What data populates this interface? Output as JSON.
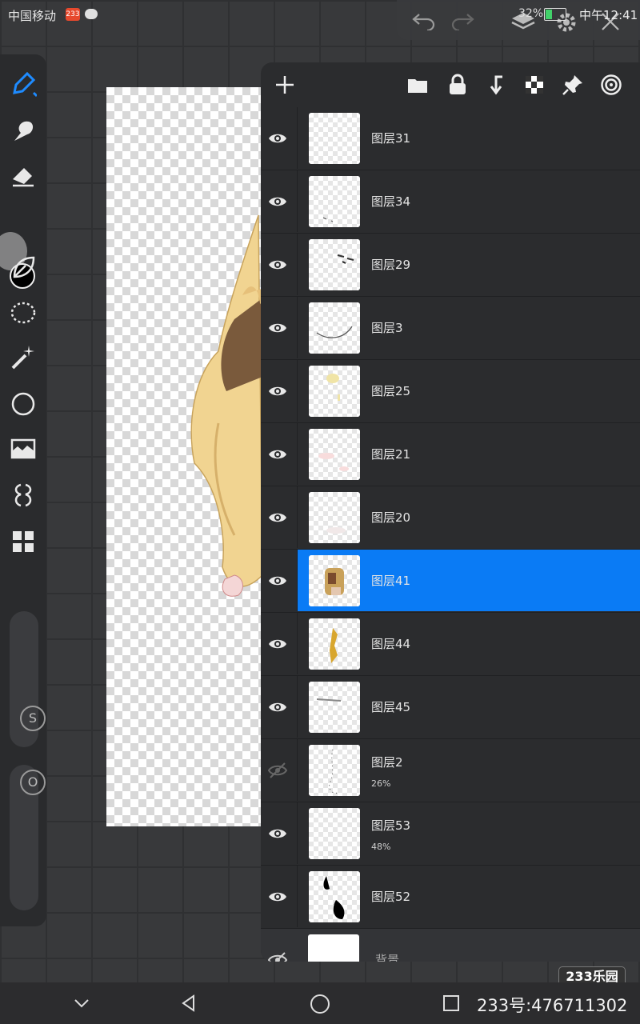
{
  "status_bar": {
    "carrier": "中国移动",
    "badge": "233",
    "battery": "32%",
    "time": "中午12:41"
  },
  "layer_panel": {
    "layers": [
      {
        "name": "图层31",
        "visible": true,
        "thumb": "blank"
      },
      {
        "name": "图层34",
        "visible": true,
        "thumb": "marks"
      },
      {
        "name": "图层29",
        "visible": true,
        "thumb": "eyes"
      },
      {
        "name": "图层3",
        "visible": true,
        "thumb": "curve"
      },
      {
        "name": "图层25",
        "visible": true,
        "thumb": "yellow"
      },
      {
        "name": "图层21",
        "visible": true,
        "thumb": "pink"
      },
      {
        "name": "图层20",
        "visible": true,
        "thumb": "faint"
      },
      {
        "name": "图层41",
        "visible": true,
        "thumb": "figure",
        "selected": true
      },
      {
        "name": "图层44",
        "visible": true,
        "thumb": "gold"
      },
      {
        "name": "图层45",
        "visible": true,
        "thumb": "lines"
      },
      {
        "name": "图层2",
        "visible": false,
        "opacity": "26%",
        "thumb": "dots"
      },
      {
        "name": "图层53",
        "visible": true,
        "opacity": "48%",
        "thumb": "blank"
      },
      {
        "name": "图层52",
        "visible": true,
        "thumb": "black"
      },
      {
        "name": "背景",
        "visible": false,
        "thumb": "white",
        "background": true
      }
    ]
  },
  "nav_bar": {
    "user_id": "233号:476711302"
  },
  "watermark": "233乐园",
  "colors": {
    "accent": "#0a7bf5",
    "current_color": "#000000"
  }
}
